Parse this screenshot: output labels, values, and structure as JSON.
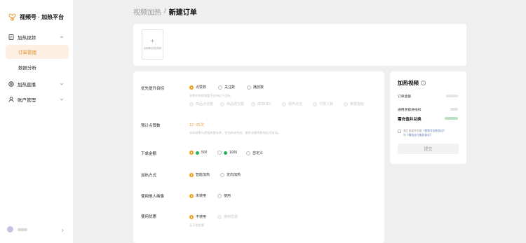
{
  "app": {
    "title": "视频号 · 加热平台"
  },
  "sidebar": {
    "groups": [
      {
        "label": "加热视频",
        "icon": "document-icon",
        "subs": [
          {
            "label": "订单管理",
            "active": true
          },
          {
            "label": "数据分析",
            "active": false
          }
        ]
      },
      {
        "label": "加热直播",
        "icon": "live-icon"
      },
      {
        "label": "账户管理",
        "icon": "user-icon"
      }
    ]
  },
  "breadcrumb": {
    "parent": "视频加热",
    "separator": "/",
    "current": "新建订单"
  },
  "upload": {
    "icon": "plus-icon",
    "hint": "选择要加热的视频"
  },
  "form": {
    "goal": {
      "label": "优先提升目标",
      "options": [
        "点赞数",
        "关注数",
        "播放数"
      ],
      "selected": 0,
      "note": "长期作的视频暂不支持以下目标",
      "disabled_options": [
        "商品点击数",
        "商品成交数",
        "成交ROI",
        "组件点击",
        "付费人数",
        "参数指标"
      ]
    },
    "estimate": {
      "label": "预计点赞数",
      "value": "12~25次",
      "note": "实际效果与视频质量有关，受加热未完成、剩余流量等影响区间波动。"
    },
    "amount": {
      "label": "下单金额",
      "options": [
        "500",
        "1000",
        "自定义"
      ],
      "selected": 0
    },
    "method": {
      "label": "加热方式",
      "options": [
        "智能加热",
        "定向加热"
      ],
      "selected": 0
    },
    "portrait": {
      "label": "使用他人画像",
      "options": [
        "未使用",
        "使用"
      ],
      "selected": 0
    },
    "coupon": {
      "label": "使用优惠",
      "options": [
        "不使用",
        "使用优惠"
      ],
      "selected": 0,
      "note": "无可用优惠"
    }
  },
  "summary": {
    "title": "加热视频",
    "order_amount_label": "订单金额",
    "balance_label": "通用余额将抵扣",
    "recharge_label": "需充值并兑换",
    "agreement": {
      "prefix": "我已阅读并同意",
      "link1": "《视频号加热协议》",
      "and": "和",
      "link2": "《微信支付服务协议》"
    },
    "submit": "提交"
  },
  "colors": {
    "accent": "#f0a010",
    "active_bg": "#fdf0e3",
    "active_text": "#e08a1e",
    "link": "#5b7db5",
    "coin": "#27b35a"
  }
}
